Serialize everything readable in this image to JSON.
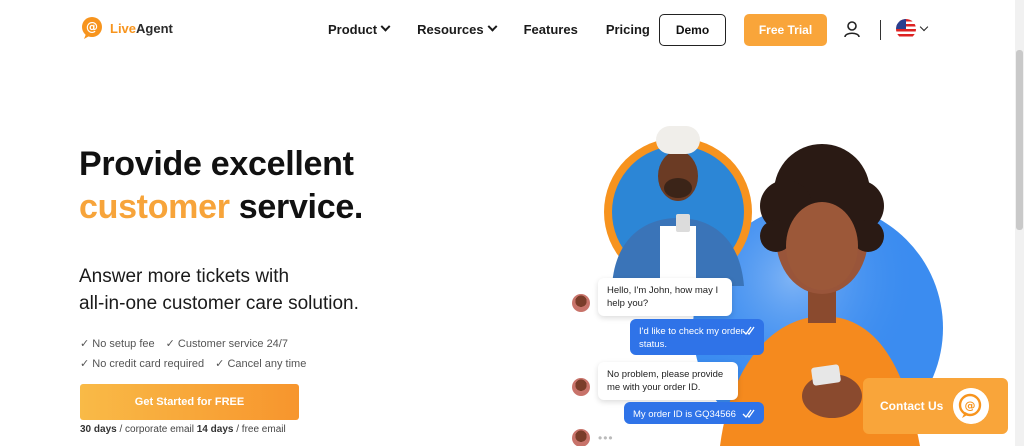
{
  "header": {
    "logo_text_live": "Live",
    "logo_text_agent": "Agent",
    "nav": [
      {
        "label": "Product",
        "has_dropdown": true
      },
      {
        "label": "Resources",
        "has_dropdown": true
      },
      {
        "label": "Features",
        "has_dropdown": false
      },
      {
        "label": "Pricing",
        "has_dropdown": false
      }
    ],
    "demo_label": "Demo",
    "trial_label": "Free Trial",
    "user_icon": "user-icon",
    "language_icon": "us-flag-icon"
  },
  "hero": {
    "title_line1": "Provide excellent",
    "title_accent": "customer",
    "title_rest": " service.",
    "subtitle_line1": "Answer more tickets with",
    "subtitle_line2": "all-in-one customer care solution.",
    "checks": [
      [
        "✓ No setup fee",
        "✓ Customer service 24/7"
      ],
      [
        "✓ No credit card required",
        "✓ Cancel any time"
      ]
    ],
    "cta_label": "Get Started for FREE",
    "note_days1": "30 days",
    "note_text1": " / corporate email ",
    "note_days2": "14 days",
    "note_text2": " / free email"
  },
  "chat": {
    "messages": [
      {
        "dir": "in",
        "text": "Hello, I'm John, how may I help you?"
      },
      {
        "dir": "out",
        "text": "I'd like to check my order status."
      },
      {
        "dir": "in",
        "text": "No problem, please provide me with your order ID."
      },
      {
        "dir": "out",
        "text": "My order ID is GQ34566"
      }
    ],
    "read_icon": "double-check-icon",
    "typing": "•••"
  },
  "contact_widget": {
    "label": "Contact Us",
    "icon": "chat-bubble-icon"
  },
  "colors": {
    "accent": "#f7a43a",
    "chat_blue": "#2f73e8",
    "circle_blue": "#3b8cf0"
  }
}
